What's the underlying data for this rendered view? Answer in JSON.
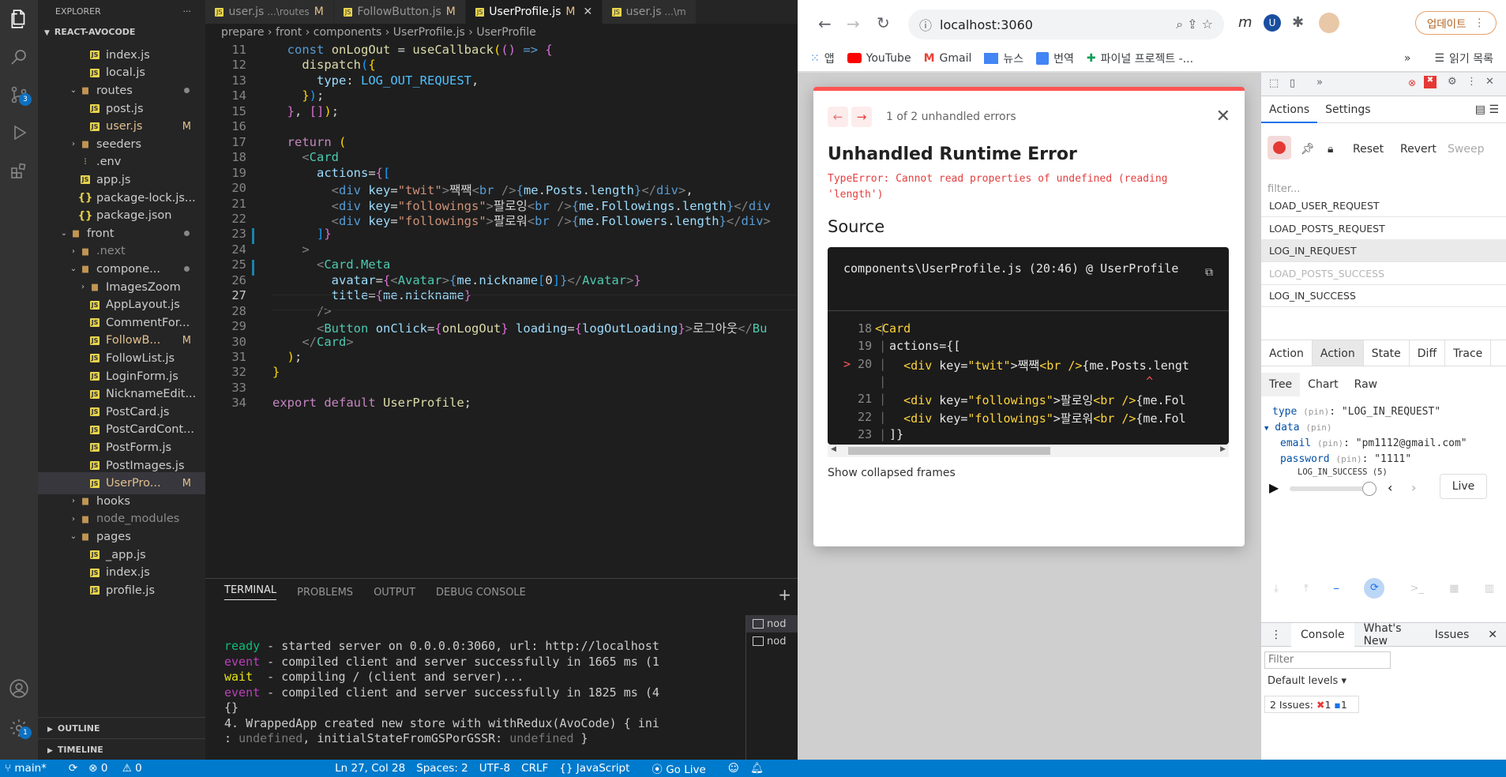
{
  "vscode": {
    "explorer": {
      "title": "EXPLORER",
      "root": "REACT-AVOCODE",
      "items": [
        {
          "label": "index.js",
          "type": "js",
          "indent": 3
        },
        {
          "label": "local.js",
          "type": "js",
          "indent": 3
        },
        {
          "label": "routes",
          "type": "folder",
          "indent": 2,
          "open": true,
          "dot": true
        },
        {
          "label": "post.js",
          "type": "js",
          "indent": 3
        },
        {
          "label": "user.js",
          "type": "js",
          "indent": 3,
          "mark": "M"
        },
        {
          "label": "seeders",
          "type": "folder",
          "indent": 2,
          "open": false
        },
        {
          "label": ".env",
          "type": "env",
          "indent": 2
        },
        {
          "label": "app.js",
          "type": "js",
          "indent": 2
        },
        {
          "label": "package-lock.js...",
          "type": "json",
          "indent": 2
        },
        {
          "label": "package.json",
          "type": "json",
          "indent": 2
        },
        {
          "label": "front",
          "type": "folder",
          "indent": 1,
          "open": true,
          "dot": true
        },
        {
          "label": ".next",
          "type": "folder",
          "indent": 2,
          "open": false,
          "dim": true
        },
        {
          "label": "compone...",
          "type": "folder",
          "indent": 2,
          "open": true,
          "dot": true
        },
        {
          "label": "ImagesZoom",
          "type": "folder",
          "indent": 3,
          "open": false
        },
        {
          "label": "AppLayout.js",
          "type": "js",
          "indent": 3
        },
        {
          "label": "CommentFor...",
          "type": "js",
          "indent": 3
        },
        {
          "label": "FollowB...",
          "type": "js",
          "indent": 3,
          "mark": "M"
        },
        {
          "label": "FollowList.js",
          "type": "js",
          "indent": 3
        },
        {
          "label": "LoginForm.js",
          "type": "js",
          "indent": 3
        },
        {
          "label": "NicknameEdit...",
          "type": "js",
          "indent": 3
        },
        {
          "label": "PostCard.js",
          "type": "js",
          "indent": 3
        },
        {
          "label": "PostCardCont...",
          "type": "js",
          "indent": 3
        },
        {
          "label": "PostForm.js",
          "type": "js",
          "indent": 3
        },
        {
          "label": "PostImages.js",
          "type": "js",
          "indent": 3
        },
        {
          "label": "UserPro...",
          "type": "js",
          "indent": 3,
          "mark": "M",
          "selected": true
        },
        {
          "label": "hooks",
          "type": "folder",
          "indent": 2,
          "open": false
        },
        {
          "label": "node_modules",
          "type": "folder",
          "indent": 2,
          "open": false,
          "dim": true
        },
        {
          "label": "pages",
          "type": "folder",
          "indent": 2,
          "open": true
        },
        {
          "label": "_app.js",
          "type": "js",
          "indent": 3
        },
        {
          "label": "index.js",
          "type": "js",
          "indent": 3
        },
        {
          "label": "profile.js",
          "type": "js",
          "indent": 3
        }
      ],
      "outline": "OUTLINE",
      "timeline": "TIMELINE"
    },
    "tabs": [
      {
        "label": "user.js",
        "desc": "...\\routes",
        "mark": "M",
        "active": false
      },
      {
        "label": "FollowButton.js",
        "desc": "",
        "mark": "M",
        "active": false
      },
      {
        "label": "UserProfile.js",
        "desc": "",
        "mark": "M",
        "active": true
      },
      {
        "label": "user.js",
        "desc": "...\\m",
        "mark": "",
        "active": false
      }
    ],
    "breadcrumb": "prepare  ›  front  ›  components  ›  UserProfile.js  ›  UserProfile",
    "code_lines": [
      {
        "n": 11,
        "html": "  <span class='kw'>const</span> <span class='fn'>onLogOut</span> = <span class='fn'>useCallback</span><span class='br1'>(</span><span class='br2'>()</span> <span class='kw'>=&gt;</span> <span class='br2'>{</span>"
      },
      {
        "n": 12,
        "html": "    <span class='fn'>dispatch</span><span class='br3'>(</span><span class='br1'>{</span>"
      },
      {
        "n": 13,
        "html": "      <span class='vr'>type</span>: <span class='cn'>LOG_OUT_REQUEST</span>,"
      },
      {
        "n": 14,
        "html": "    <span class='br1'>}</span><span class='br3'>)</span>;"
      },
      {
        "n": 15,
        "html": "  <span class='br2'>}</span>, <span class='br2'>[]</span><span class='br1'>)</span>;"
      },
      {
        "n": 16,
        "html": ""
      },
      {
        "n": 17,
        "html": "  <span class='kc'>return</span> <span class='br1'>(</span>"
      },
      {
        "n": 18,
        "html": "    <span class='pn'>&lt;</span><span class='tg'>Card</span>"
      },
      {
        "n": 19,
        "html": "      <span class='vr'>actions</span>=<span class='br2'>{</span><span class='br3'>[</span>"
      },
      {
        "n": 20,
        "html": "        <span class='pn'>&lt;</span><span class='kw'>div</span> <span class='vr'>key</span>=<span class='st'>\"twit\"</span><span class='pn'>&gt;</span>짹짹<span class='pn'>&lt;</span><span class='kw'>br</span> <span class='pn'>/&gt;</span><span class='kw'>{</span><span class='vr'>me</span>.<span class='vr'>Posts</span>.<span class='vr'>length</span><span class='kw'>}</span><span class='pn'>&lt;/</span><span class='kw'>div</span><span class='pn'>&gt;</span>,"
      },
      {
        "n": 21,
        "html": "        <span class='pn'>&lt;</span><span class='kw'>div</span> <span class='vr'>key</span>=<span class='st'>\"followings\"</span><span class='pn'>&gt;</span>팔로잉<span class='pn'>&lt;</span><span class='kw'>br</span> <span class='pn'>/&gt;</span><span class='kw'>{</span><span class='vr'>me</span>.<span class='vr'>Followings</span>.<span class='vr'>length</span><span class='kw'>}</span><span class='pn'>&lt;/</span><span class='kw'>div</span>"
      },
      {
        "n": 22,
        "html": "        <span class='pn'>&lt;</span><span class='kw'>div</span> <span class='vr'>key</span>=<span class='st'>\"followings\"</span><span class='pn'>&gt;</span>팔로워<span class='pn'>&lt;</span><span class='kw'>br</span> <span class='pn'>/&gt;</span><span class='kw'>{</span><span class='vr'>me</span>.<span class='vr'>Followers</span>.<span class='vr'>length</span><span class='kw'>}</span><span class='pn'>&lt;/</span><span class='kw'>div</span><span class='pn'>&gt;</span>"
      },
      {
        "n": 23,
        "html": "      <span class='br3'>]</span><span class='br2'>}</span>"
      },
      {
        "n": 24,
        "html": "    <span class='pn'>&gt;</span>"
      },
      {
        "n": 25,
        "html": "      <span class='pn'>&lt;</span><span class='tg'>Card.Meta</span>"
      },
      {
        "n": 26,
        "html": "        <span class='vr'>avatar</span>=<span class='br2'>{</span><span class='pn'>&lt;</span><span class='tg'>Avatar</span><span class='pn'>&gt;</span><span class='kw'>{</span><span class='vr'>me</span>.<span class='vr'>nickname</span><span class='br3'>[</span><span class='cm'>0</span><span class='br3'>]</span><span class='kw'>}</span><span class='pn'>&lt;/</span><span class='tg'>Avatar</span><span class='pn'>&gt;</span><span class='br2'>}</span>"
      },
      {
        "n": 27,
        "html": "        <span class='vr'>title</span>=<span class='br2'>{</span><span class='vr'>me</span>.<span class='vr'>nickname</span><span class='br2'>}</span>"
      },
      {
        "n": 28,
        "html": "      <span class='pn'>/&gt;</span>"
      },
      {
        "n": 29,
        "html": "      <span class='pn'>&lt;</span><span class='tg'>Button</span> <span class='vr'>onClick</span>=<span class='br2'>{</span><span class='fn'>onLogOut</span><span class='br2'>}</span> <span class='vr'>loading</span>=<span class='br2'>{</span><span class='vr'>logOutLoading</span><span class='br2'>}</span><span class='pn'>&gt;</span>로그아웃<span class='pn'>&lt;/</span><span class='tg'>Bu</span>"
      },
      {
        "n": 30,
        "html": "    <span class='pn'>&lt;/</span><span class='tg'>Card</span><span class='pn'>&gt;</span>"
      },
      {
        "n": 31,
        "html": "  <span class='br1'>)</span>;"
      },
      {
        "n": 32,
        "html": "<span class='br1'>}</span>"
      },
      {
        "n": 33,
        "html": ""
      },
      {
        "n": 34,
        "html": "<span class='kc'>export</span> <span class='kc'>default</span> <span class='fn'>UserProfile</span>;"
      }
    ],
    "terminal": {
      "tabs": [
        "TERMINAL",
        "PROBLEMS",
        "OUTPUT",
        "DEBUG CONSOLE"
      ],
      "side_items": [
        "nod",
        "nod"
      ],
      "lines": [
        {
          "html": "<span class='tg2'>ready</span> - started server on 0.0.0.0:3060, url: http://localhost"
        },
        {
          "html": "<span class='tp'>event</span> - compiled client and server successfully in 1665 ms (1"
        },
        {
          "html": "<span class='ty'>wait</span>  - compiling / (client and server)..."
        },
        {
          "html": "<span class='tp'>event</span> - compiled client and server successfully in 1825 ms (4"
        },
        {
          "html": "{}"
        },
        {
          "html": "4. WrappedApp created new store with withRedux(AvoCode) { ini"
        },
        {
          "html": ": <span class='tdim'>undefined</span>, initialStateFromGSPorGSSR: <span class='tdim'>undefined</span> }"
        }
      ]
    },
    "status": {
      "branch": "main*",
      "errors": "0",
      "warnings": "0",
      "position": "Ln 27, Col 28",
      "spaces": "Spaces: 2",
      "encoding": "UTF-8",
      "eol": "CRLF",
      "language": "JavaScript",
      "golive": "Go Live"
    },
    "scm_badge": "3",
    "settings_badge": "1"
  },
  "browser": {
    "url": "localhost:3060",
    "update_label": "업데이트",
    "bookmarks": [
      "앱",
      "YouTube",
      "Gmail",
      "뉴스",
      "번역",
      "파이널 프로젝트 -..."
    ],
    "reading_list": "읽기 목록",
    "error_overlay": {
      "counter": "1 of 2 unhandled errors",
      "title": "Unhandled Runtime Error",
      "message": "TypeError: Cannot read properties of undefined (reading 'length')",
      "source_label": "Source",
      "file_ref": "components\\UserProfile.js (20:46) @ UserProfile",
      "lines": [
        {
          "n": "18",
          "html": "<span class='yt'>&lt;Card</span>"
        },
        {
          "n": "19",
          "html": "  actions={["
        },
        {
          "n": "20",
          "html": "    <span class='yt'>&lt;div</span> key=<span class='yt'>\"twit\"</span>&gt;짹짹<span class='yt'>&lt;br /&gt;</span>{me.Posts.lengt"
        },
        {
          "n": "",
          "html": "                                      <span style='color:#ff5555'>^</span>"
        },
        {
          "n": "21",
          "html": "    <span class='yt'>&lt;div</span> key=<span class='yt'>\"followings\"</span>&gt;팔로잉<span class='yt'>&lt;br /&gt;</span>{me.Fol"
        },
        {
          "n": "22",
          "html": "    <span class='yt'>&lt;div</span> key=<span class='yt'>\"followings\"</span>&gt;팔로워<span class='yt'>&lt;br /&gt;</span>{me.Fol"
        },
        {
          "n": "23",
          "html": "  ]}"
        }
      ],
      "show_collapsed": "Show collapsed frames"
    },
    "devtools": {
      "tabs": [
        "Actions",
        "Settings"
      ],
      "buttons": [
        "Reset",
        "Revert",
        "Sweep"
      ],
      "filter_placeholder": "filter...",
      "actions": [
        {
          "name": "LOAD_USER_REQUEST",
          "dim": false
        },
        {
          "name": "LOAD_POSTS_REQUEST",
          "dim": false
        },
        {
          "name": "LOG_IN_REQUEST",
          "dim": false,
          "hl": true
        },
        {
          "name": "LOAD_POSTS_SUCCESS",
          "dim": true
        },
        {
          "name": "LOG_IN_SUCCESS",
          "dim": false
        }
      ],
      "subtabs": [
        "Action",
        "Action",
        "State",
        "Diff",
        "Trace"
      ],
      "views": [
        "Tree",
        "Chart",
        "Raw"
      ],
      "tree": {
        "type_key": "type",
        "type_val": "\"LOG_IN_REQUEST\"",
        "data_key": "data",
        "email_key": "email",
        "email_val": "\"pm1112@gmail.com\"",
        "password_key": "password",
        "password_val": "\"1111\"",
        "pin": "(pin)"
      },
      "slider_label": "LOG_IN_SUCCESS (5)",
      "live_label": "Live",
      "console": {
        "tabs": [
          "Console",
          "What's New",
          "Issues"
        ],
        "filter_placeholder": "Filter",
        "levels": "Default levels",
        "issues": "2 Issues:",
        "issues_red": "1",
        "issues_blue": "1"
      }
    }
  }
}
